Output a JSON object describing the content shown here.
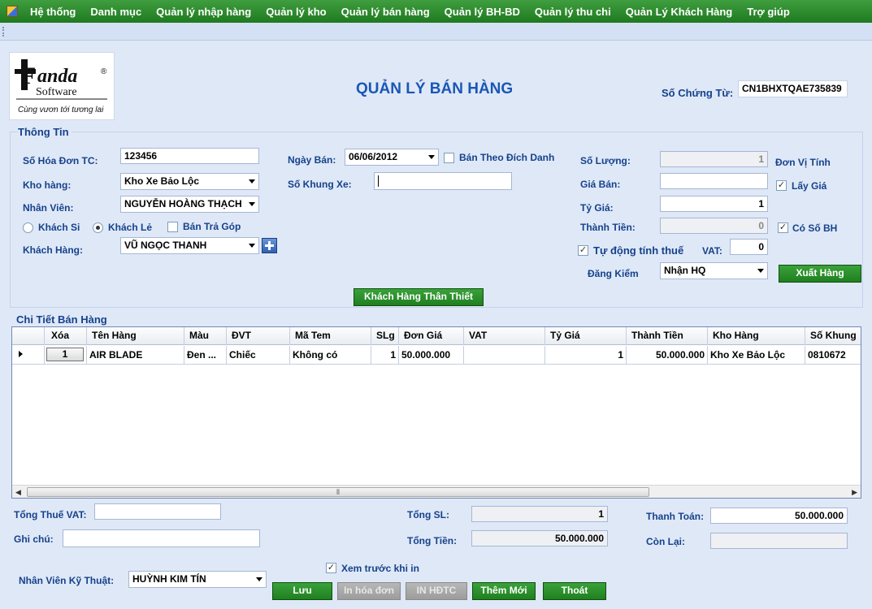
{
  "menu": [
    "Hệ thống",
    "Danh mục",
    "Quản lý nhập hàng",
    "Quản lý kho",
    "Quản lý bán hàng",
    "Quản lý BH-BD",
    "Quản lý thu chi",
    "Quản Lý Khách Hàng",
    "Trợ giúp"
  ],
  "logo": {
    "brand_prefix": "F",
    "brand_main": "anda",
    "brand_sub": "Software",
    "registered": "®",
    "tagline": "Cùng vươn tới tương lai"
  },
  "header": {
    "title": "QUẢN LÝ BÁN HÀNG",
    "voucher_label": "Số Chứng Từ:",
    "voucher_value": "CN1BHXTQAE735839"
  },
  "info": {
    "group_title": "Thông Tin",
    "invoice_label": "Số Hóa Đơn TC:",
    "invoice_value": "123456",
    "warehouse_label": "Kho hàng:",
    "warehouse_value": "Kho Xe Bảo Lộc",
    "staff_label": "Nhân Viên:",
    "staff_value": "NGUYỄN HOÀNG THẠCH",
    "radio_wholesale": "Khách Si",
    "radio_retail": "Khách Lẻ",
    "installment": "Bán Trả Góp",
    "customer_label": "Khách Hàng:",
    "customer_value": "VŨ NGỌC THANH",
    "sale_date_label": "Ngày Bán:",
    "sale_date_value": "06/06/2012",
    "sell_by_name": "Bán Theo Đích Danh",
    "frame_label": "Số Khung Xe:",
    "frame_value": "",
    "qty_label": "Số Lượng:",
    "qty_value": "1",
    "unit_label": "Đơn Vị Tính",
    "price_label": "Giá Bán:",
    "price_value": "",
    "get_price": "Lấy Giá",
    "rate_label": "Tỷ Giá:",
    "rate_value": "1",
    "amount_label": "Thành Tiền:",
    "amount_value": "0",
    "has_warranty": "Có Số BH",
    "auto_tax": "Tự động tính thuế",
    "vat_label": "VAT:",
    "vat_value": "0",
    "registration_label": "Đăng Kiểm",
    "registration_value": "Nhận HQ",
    "export_button": "Xuất Hàng",
    "loyal_button": "Khách Hàng Thân Thiết"
  },
  "detail": {
    "group_title": "Chi Tiết Bán Hàng",
    "columns": [
      "Xóa",
      "Tên Hàng",
      "Màu",
      "ĐVT",
      "Mã Tem",
      "SLg",
      "Đơn Giá",
      "VAT",
      "Tỷ Giá",
      "Thành Tiền",
      "Kho Hàng",
      "Số Khung"
    ],
    "rows": [
      [
        "1",
        "AIR BLADE",
        "Đen ...",
        "Chiếc",
        "Không có",
        "1",
        "50.000.000",
        "",
        "1",
        "50.000.000",
        "Kho Xe Bảo Lộc",
        "0810672"
      ]
    ]
  },
  "footer": {
    "total_vat_label": "Tổng Thuế VAT:",
    "total_vat_value": "",
    "note_label": "Ghi chú:",
    "note_value": "",
    "total_qty_label": "Tổng SL:",
    "total_qty_value": "1",
    "total_money_label": "Tổng Tiền:",
    "total_money_value": "50.000.000",
    "payment_label": "Thanh Toán:",
    "payment_value": "50.000.000",
    "remaining_label": "Còn Lại:",
    "remaining_value": "",
    "preview_label": "Xem trước khi in",
    "tech_label": "Nhân Viên Kỹ Thuật:",
    "tech_value": "HUỲNH KIM TÍN",
    "save": "Lưu",
    "print_invoice": "In hóa đơn",
    "print_hdtc": "IN HĐTC",
    "add_new": "Thêm Mới",
    "exit": "Thoát"
  },
  "colors": {
    "menu_green": "#2a8a2a",
    "panel_bg": "#dfe8f7",
    "label_blue": "#15428b"
  }
}
